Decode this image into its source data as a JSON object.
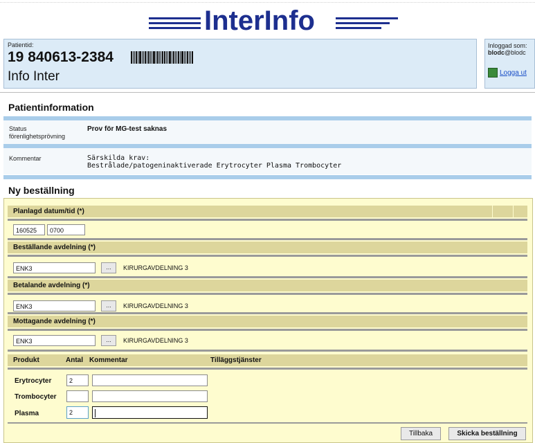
{
  "header": {
    "logo_text": "InterInfo"
  },
  "patient": {
    "id_label": "Patientid:",
    "id": "19 840613-2384",
    "name": "Info Inter"
  },
  "user": {
    "label": "Inloggad som:",
    "name_bold": "blodc",
    "name_rest": "@blodc",
    "logout": "Logga ut"
  },
  "patient_info": {
    "title": "Patientinformation",
    "rows": [
      {
        "key_line1": "Status",
        "key_line2": "förenlighetsprövning",
        "value": "Prov för MG-test saknas"
      },
      {
        "key_line1": "Kommentar",
        "key_line2": "",
        "value_line1": "Särskilda krav:",
        "value_line2": "Bestrålade/patogeninaktiverade Erytrocyter Plasma Trombocyter"
      }
    ]
  },
  "order": {
    "title": "Ny beställning",
    "planned": {
      "label": "Planlagd datum/tid (*)",
      "date": "160525",
      "time": "0700"
    },
    "ordering_dept": {
      "label": "Beställande avdelning (*)",
      "code": "ENK3",
      "name": "KIRURGAVDELNING 3",
      "button": "..."
    },
    "paying_dept": {
      "label": "Betalande avdelning (*)",
      "code": "ENK3",
      "name": "KIRURGAVDELNING 3",
      "button": "..."
    },
    "receiving_dept": {
      "label": "Mottagande avdelning (*)",
      "code": "ENK3",
      "name": "KIRURGAVDELNING 3",
      "button": "..."
    },
    "products_header": {
      "product": "Produkt",
      "count": "Antal",
      "comment": "Kommentar",
      "extras": "Tilläggstjänster"
    },
    "products": [
      {
        "name": "Erytrocyter",
        "count": "2",
        "comment": ""
      },
      {
        "name": "Trombocyter",
        "count": "",
        "comment": ""
      },
      {
        "name": "Plasma",
        "count": "2",
        "comment": ""
      }
    ],
    "buttons": {
      "back": "Tillbaka",
      "submit": "Skicka beställning"
    }
  },
  "colors": {
    "brand": "#1d2f8f",
    "patient_bg": "#dcebf7",
    "form_bg": "#fefccf",
    "form_header": "#ddd69c",
    "link": "#1a4fc7"
  },
  "icons": {
    "logout": "door-exit-icon",
    "barcode": "barcode-icon"
  }
}
